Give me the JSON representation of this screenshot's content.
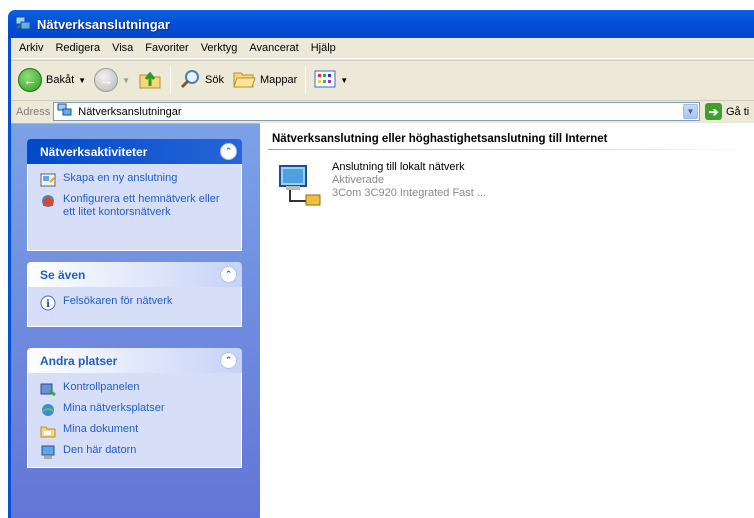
{
  "window": {
    "title": "Nätverksanslutningar"
  },
  "menu": [
    "Arkiv",
    "Redigera",
    "Visa",
    "Favoriter",
    "Verktyg",
    "Avancerat",
    "Hjälp"
  ],
  "toolbar": {
    "back_label": "Bakåt",
    "search_label": "Sök",
    "folders_label": "Mappar"
  },
  "address": {
    "label": "Adress",
    "value": "Nätverksanslutningar",
    "go_label": "Gå ti"
  },
  "sidebar": {
    "tasks": {
      "title": "Nätverksaktiviteter",
      "items": [
        {
          "label": "Skapa en ny anslutning",
          "icon": "new-connection-icon"
        },
        {
          "label": "Konfigurera ett hemnätverk eller ett litet kontorsnätverk",
          "icon": "home-network-icon"
        }
      ]
    },
    "see_also": {
      "title": "Se även",
      "items": [
        {
          "label": "Felsökaren för nätverk",
          "icon": "info-icon"
        }
      ]
    },
    "other_places": {
      "title": "Andra platser",
      "items": [
        {
          "label": "Kontrollpanelen",
          "icon": "control-panel-icon"
        },
        {
          "label": "Mina nätverksplatser",
          "icon": "network-places-icon"
        },
        {
          "label": "Mina dokument",
          "icon": "my-documents-icon"
        },
        {
          "label": "Den här datorn",
          "icon": "my-computer-icon"
        }
      ]
    }
  },
  "content": {
    "section_title": "Nätverksanslutning eller höghastighetsanslutning till Internet",
    "connections": [
      {
        "name": "Anslutning till lokalt nätverk",
        "status": "Aktiverade",
        "device": "3Com 3C920 Integrated Fast ..."
      }
    ]
  },
  "colors": {
    "title_bar": "#0550d8",
    "sidebar_gradient_top": "#7ba2e7",
    "sidebar_link": "#215dc6",
    "frame": "#ece9d8"
  }
}
